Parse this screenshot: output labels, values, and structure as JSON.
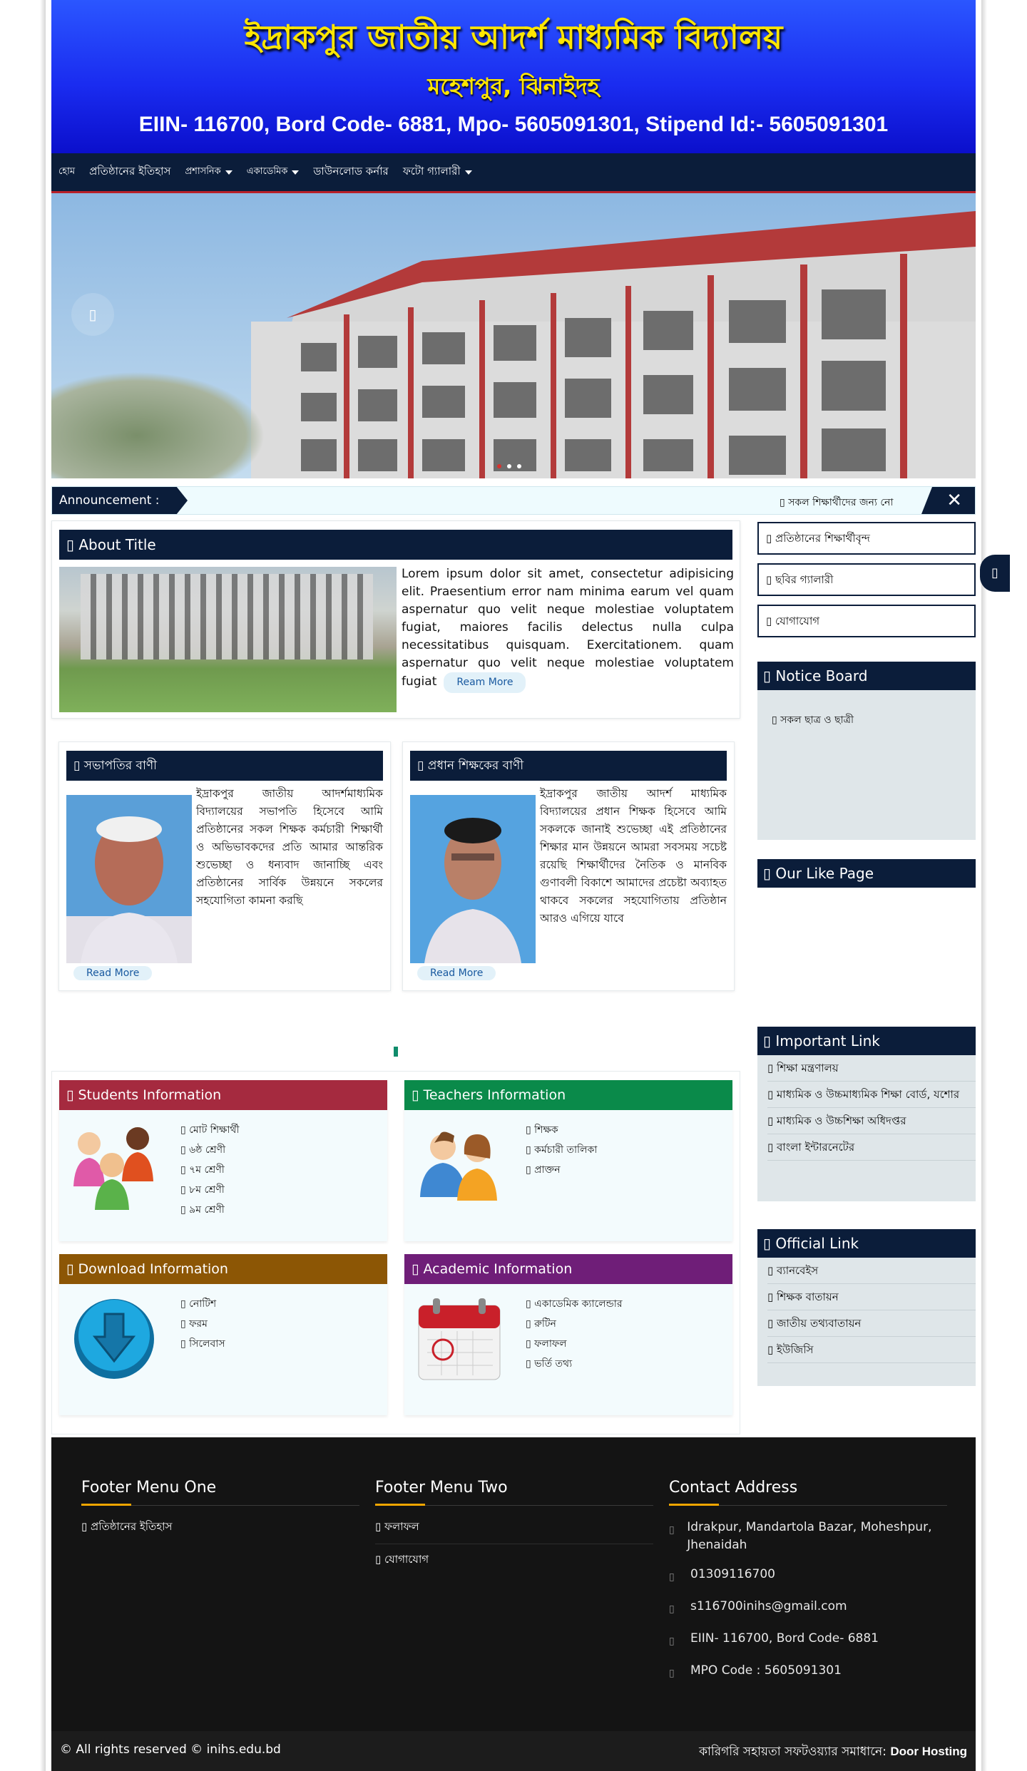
{
  "header": {
    "school_name": "ইদ্রাকপুর জাতীয় আদর্শ মাধ্যমিক বিদ্যালয়",
    "location": "মহেশপুর, ঝিনাইদহ",
    "codes": "EIIN- 116700, Bord Code- 6881, Mpo- 5605091301, Stipend Id:- 5605091301"
  },
  "nav": {
    "items": [
      {
        "label": "হোম",
        "dropdown": false
      },
      {
        "label": "প্রতিষ্ঠানের ইতিহাস",
        "dropdown": false
      },
      {
        "label": "প্রশাসনিক",
        "dropdown": true
      },
      {
        "label": "একাডেমিক",
        "dropdown": true
      },
      {
        "label": "ডাউনলোড কর্নার",
        "dropdown": false
      },
      {
        "label": "ফটো গ্যালারী",
        "dropdown": true
      }
    ]
  },
  "slider": {
    "prev_icon": "chevron-left-icon",
    "dots": 3,
    "active_dot": 0
  },
  "announcement": {
    "label": "Announcement :",
    "text": "▯ সকল শিক্ষার্থীদের জন্য নো",
    "close": "✕"
  },
  "about": {
    "title": "▯ About Title",
    "text": "Lorem ipsum dolor sit amet, consectetur adipisicing elit. Praesentium error nam minima earum vel quam aspernatur quo velit neque molestiae voluptatem fugiat, maiores facilis delectus nulla culpa necessitatibus quisquam. Exercitationem. quam aspernatur quo velit neque molestiae voluptatem fugiat",
    "more": "Ream More"
  },
  "messages": [
    {
      "title": "▯ সভাপতির বাণী",
      "text": "ইদ্রাকপুর জাতীয় আদর্শমাধ্যমিক বিদ্যালয়ের সভাপতি হিসেবে আমি প্রতিষ্ঠানের সকল শিক্ষক কর্মচারী শিক্ষার্থী ও অভিভাবকদের প্রতি আমার আন্তরিক শুভেচ্ছা ও ধন্যবাদ জানাচ্ছি এবং প্রতিষ্ঠানের সার্বিক উন্নয়নে সকলের সহযোগিতা কামনা করছি",
      "more": "Read More"
    },
    {
      "title": "▯ প্রধান শিক্ষকের বাণী",
      "text": "ইদ্রাকপুর জাতীয় আদর্শ মাধ্যমিক বিদ্যালয়ের প্রধান শিক্ষক হিসেবে আমি সকলকে জানাই শুভেচ্ছা এই প্রতিষ্ঠানের শিক্ষার মান উন্নয়নে আমরা সবসময় সচেষ্ট রয়েছি শিক্ষার্থীদের নৈতিক ও মানবিক গুণাবলী বিকাশে আমাদের প্রচেষ্টা অব্যাহত থাকবে সকলের সহযোগিতায় প্রতিষ্ঠান আরও এগিয়ে যাবে",
      "more": "Read More"
    }
  ],
  "info_boxes": [
    {
      "title": "▯ Students Information",
      "color": "#a52a3f",
      "icon": "students-icon",
      "items": [
        "▯ মোট শিক্ষার্থী",
        "▯ ৬ষ্ঠ শ্রেণী",
        "▯ ৭ম শ্রেণী",
        "▯ ৮ম শ্রেণী",
        "▯ ৯ম শ্রেণী"
      ]
    },
    {
      "title": "▯ Teachers Information",
      "color": "#0a8a4a",
      "icon": "teachers-icon",
      "items": [
        "▯ শিক্ষক",
        "▯ কর্মচারী তালিকা",
        "▯ প্রাক্তন"
      ]
    },
    {
      "title": "▯ Download Information",
      "color": "#8c5605",
      "icon": "download-icon",
      "items": [
        "▯ নোটিশ",
        "▯ ফরম",
        "▯ সিলেবাস"
      ]
    },
    {
      "title": "▯ Academic Information",
      "color": "#6f1e78",
      "icon": "calendar-icon",
      "items": [
        "▯ একাডেমিক ক্যালেন্ডার",
        "▯ রুটিন",
        "▯ ফলাফল",
        "▯ ভর্তি তথ্য"
      ]
    }
  ],
  "sidebar": {
    "quick_buttons": [
      "▯ প্রতিষ্ঠানের শিক্ষার্থীবৃন্দ",
      "▯ ছবির গ্যালারী",
      "▯ যোগাযোগ"
    ],
    "notice_title": "▯ Notice Board",
    "notice_items": [
      "▯ সকল ছাত্র ও ছাত্রী"
    ],
    "like_title": "▯ Our Like Page",
    "important_title": "▯ Important Link",
    "important_links": [
      "▯ শিক্ষা মন্ত্রণালয়",
      "▯ মাধ্যমিক ও উচ্চমাধ্যমিক শিক্ষা বোর্ড, যশোর",
      "▯ মাধ্যমিক ও উচ্চশিক্ষা অধিদপ্তর",
      "▯ বাংলা ইন্টারনেটের"
    ],
    "official_title": "▯ Official Link",
    "official_links": [
      "▯ ব্যানবেইস",
      "▯ শিক্ষক বাতায়ন",
      "▯ জাতীয় তথ্যবাতায়ন",
      "▯ ইউজিসি"
    ]
  },
  "footer": {
    "col1_title": "Footer Menu One",
    "col1_links": [
      "▯ প্রতিষ্ঠানের ইতিহাস"
    ],
    "col2_title": "Footer Menu Two",
    "col2_links": [
      "▯ ফলাফল",
      "▯ যোগাযোগ"
    ],
    "col3_title": "Contact Address",
    "contact": [
      {
        "icon": "map-marker-icon",
        "text": "Idrakpur, Mandartola Bazar, Moheshpur, Jhenaidah"
      },
      {
        "icon": "phone-icon",
        "text": "01309116700"
      },
      {
        "icon": "envelope-icon",
        "text": "s116700inihs@gmail.com"
      },
      {
        "icon": "building-icon",
        "text": "EIIN- 116700, Bord Code- 6881"
      },
      {
        "icon": "id-card-icon",
        "text": "MPO Code : 5605091301"
      }
    ],
    "copyright": "© All rights reserved © inihs.edu.bd",
    "credit_prefix": "কারিগরি সহায়তা সফটওয়্যার সমাধানে:",
    "credit_name": "Door Hosting"
  }
}
